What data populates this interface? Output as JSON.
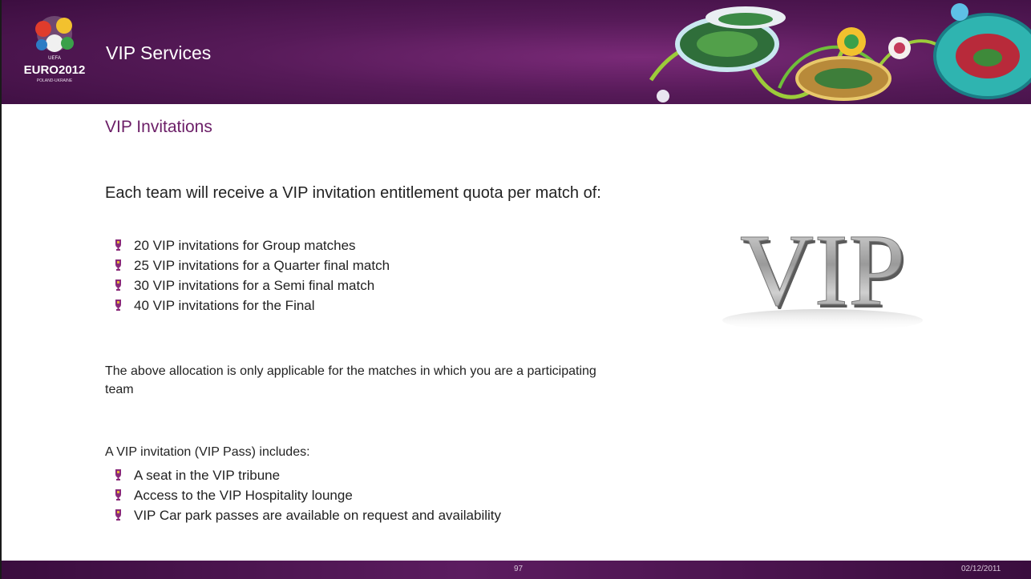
{
  "header": {
    "title": "VIP Services",
    "logo": {
      "top_text": "UEFA",
      "main_text": "EURO2012",
      "sub_text": "POLAND-UKRAINE"
    }
  },
  "section_title": "VIP Invitations",
  "intro": "Each team will receive a VIP invitation entitlement quota per match of:",
  "quotas": [
    "20 VIP invitations for Group matches",
    "25 VIP invitations for a Quarter final match",
    "30 VIP invitations for a Semi final match",
    "40 VIP invitations for the Final"
  ],
  "note": "The above allocation is only applicable for the matches in which you are a participating team",
  "includes_heading": "A VIP invitation (VIP Pass) includes:",
  "includes": [
    "A seat in the VIP tribune",
    "Access to the VIP Hospitality lounge",
    "VIP Car park passes are available on request and availability"
  ],
  "vip_graphic_text": "VIP",
  "footer": {
    "page_number": "97",
    "date": "02/12/2011"
  },
  "colors": {
    "header_purple": "#561a58",
    "accent_purple": "#6b1e67",
    "bullet": "#8a2a7a"
  }
}
